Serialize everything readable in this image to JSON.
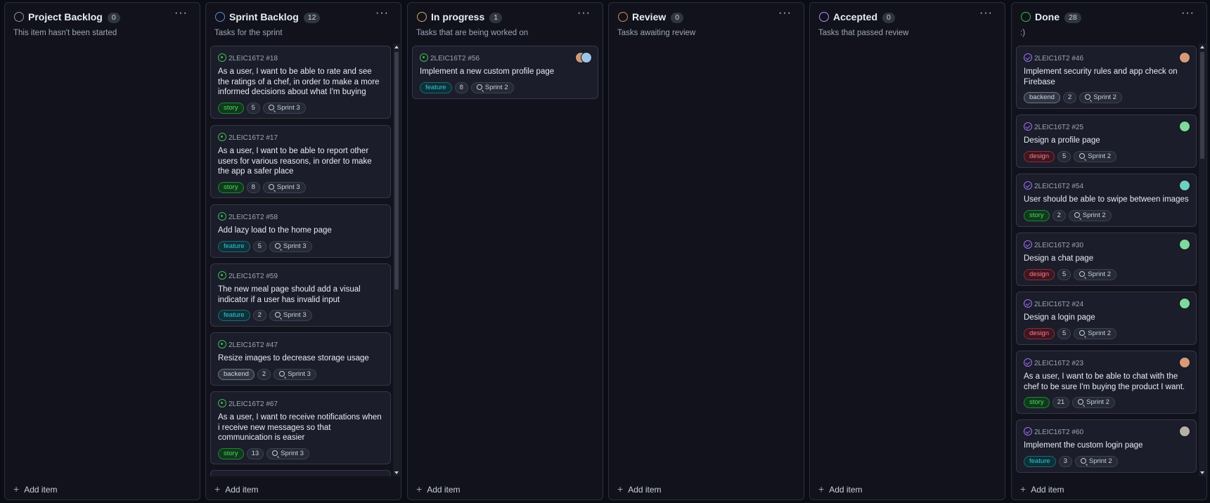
{
  "columns": [
    {
      "title": "Project Backlog",
      "count": "0",
      "description": "This item hasn't been started",
      "status_color": "#8b949e",
      "add_label": "Add item"
    },
    {
      "title": "Sprint Backlog",
      "count": "12",
      "description": "Tasks for the sprint",
      "status_color": "#5b8dd9",
      "add_label": "Add item"
    },
    {
      "title": "In progress",
      "count": "1",
      "description": "Tasks that are being worked on",
      "status_color": "#d4a86a",
      "add_label": "Add item"
    },
    {
      "title": "Review",
      "count": "0",
      "description": "Tasks awaiting review",
      "status_color": "#e08a55",
      "add_label": "Add item"
    },
    {
      "title": "Accepted",
      "count": "0",
      "description": "Tasks that passed review",
      "status_color": "#bc8cff",
      "add_label": "Add item"
    },
    {
      "title": "Done",
      "count": "28",
      "description": ":)",
      "status_color": "#3fb950",
      "add_label": "Add item"
    }
  ],
  "menu_glyph": "···",
  "plus_glyph": "+",
  "cards": {
    "sprint_backlog": [
      {
        "ref": "2LEIC16T2 #18",
        "title": "As a user, I want to be able to rate and see the ratings of a chef, in order to make a more informed decisions about what I'm buying",
        "label": "story",
        "points": "5",
        "sprint": "Sprint 3"
      },
      {
        "ref": "2LEIC16T2 #17",
        "title": "As a user, I want to be able to report other users for various reasons, in order to make the app a safer place",
        "label": "story",
        "points": "8",
        "sprint": "Sprint 3"
      },
      {
        "ref": "2LEIC16T2 #58",
        "title": "Add lazy load to the home page",
        "label": "feature",
        "points": "5",
        "sprint": "Sprint 3"
      },
      {
        "ref": "2LEIC16T2 #59",
        "title": "The new meal page should add a visual indicator if a user has invalid input",
        "label": "feature",
        "points": "2",
        "sprint": "Sprint 3"
      },
      {
        "ref": "2LEIC16T2 #47",
        "title": "Resize images to decrease storage usage",
        "label": "backend",
        "points": "2",
        "sprint": "Sprint 3"
      },
      {
        "ref": "2LEIC16T2 #67",
        "title": "As a user, I want to receive notifications when i receive new messages so that communication is easier",
        "label": "story",
        "points": "13",
        "sprint": "Sprint 3"
      }
    ],
    "in_progress": [
      {
        "ref": "2LEIC16T2 #56",
        "title": "Implement a new custom profile page",
        "label": "feature",
        "points": "8",
        "sprint": "Sprint 2"
      }
    ],
    "done": [
      {
        "ref": "2LEIC16T2 #46",
        "title": "Implement security rules and app check on Firebase",
        "label": "backend",
        "points": "2",
        "sprint": "Sprint 2"
      },
      {
        "ref": "2LEIC16T2 #25",
        "title": "Design a profile page",
        "label": "design",
        "points": "5",
        "sprint": "Sprint 2"
      },
      {
        "ref": "2LEIC16T2 #54",
        "title": "User should be able to swipe between images",
        "label": "story",
        "points": "2",
        "sprint": "Sprint 2"
      },
      {
        "ref": "2LEIC16T2 #30",
        "title": "Design a chat page",
        "label": "design",
        "points": "5",
        "sprint": "Sprint 2"
      },
      {
        "ref": "2LEIC16T2 #24",
        "title": "Design a login page",
        "label": "design",
        "points": "5",
        "sprint": "Sprint 2"
      },
      {
        "ref": "2LEIC16T2 #23",
        "title": "As a user, I want to be able to chat with the chef to be sure I'm buying the product I want.",
        "label": "story",
        "points": "21",
        "sprint": "Sprint 2"
      },
      {
        "ref": "2LEIC16T2 #60",
        "title": "Implement the custom login page",
        "label": "feature",
        "points": "3",
        "sprint": "Sprint 2"
      }
    ]
  },
  "colors": {
    "background": "#0b0d14",
    "column": "#11121c",
    "card": "#1b1d2a",
    "open_issue": "#3fb950",
    "closed_issue": "#a371f7"
  }
}
